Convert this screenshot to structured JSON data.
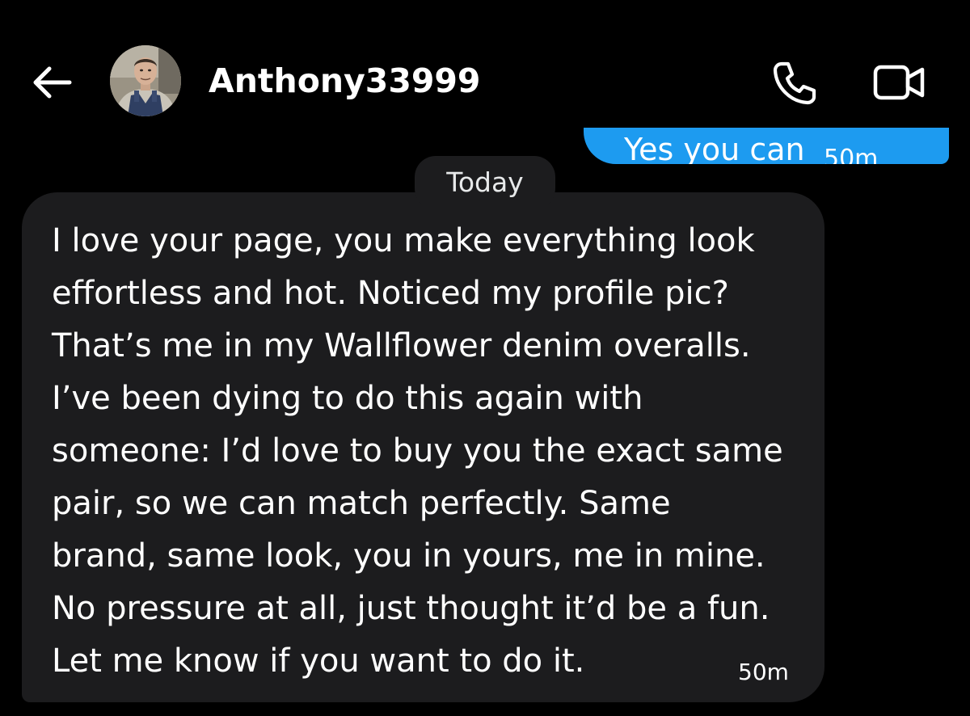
{
  "header": {
    "username": "Anthony33999",
    "back_icon": "arrow-left-icon",
    "call_icon": "phone-icon",
    "video_icon": "video-camera-icon"
  },
  "outgoing_message": {
    "text": "Yes you can",
    "timestamp": "50m",
    "status_icon": "read-check-icon"
  },
  "date_separator": "Today",
  "incoming_message": {
    "lines": [
      "I love your page, you make everything look",
      "effortless and hot. Noticed my profile pic?",
      "That’s me in my Wallflower denim overalls.",
      "I’ve been dying to do this again with",
      "someone: I’d love to buy you the exact same",
      "pair, so we can match perfectly. Same",
      "brand, same look, you in yours, me in mine.",
      "No pressure at all, just thought it’d be a fun.",
      "Let me know if you want to do it."
    ],
    "timestamp": "50m"
  },
  "colors": {
    "background": "#000000",
    "outgoing_bubble": "#1d9bf0",
    "incoming_bubble": "#1c1c1e",
    "text": "#ffffff"
  }
}
